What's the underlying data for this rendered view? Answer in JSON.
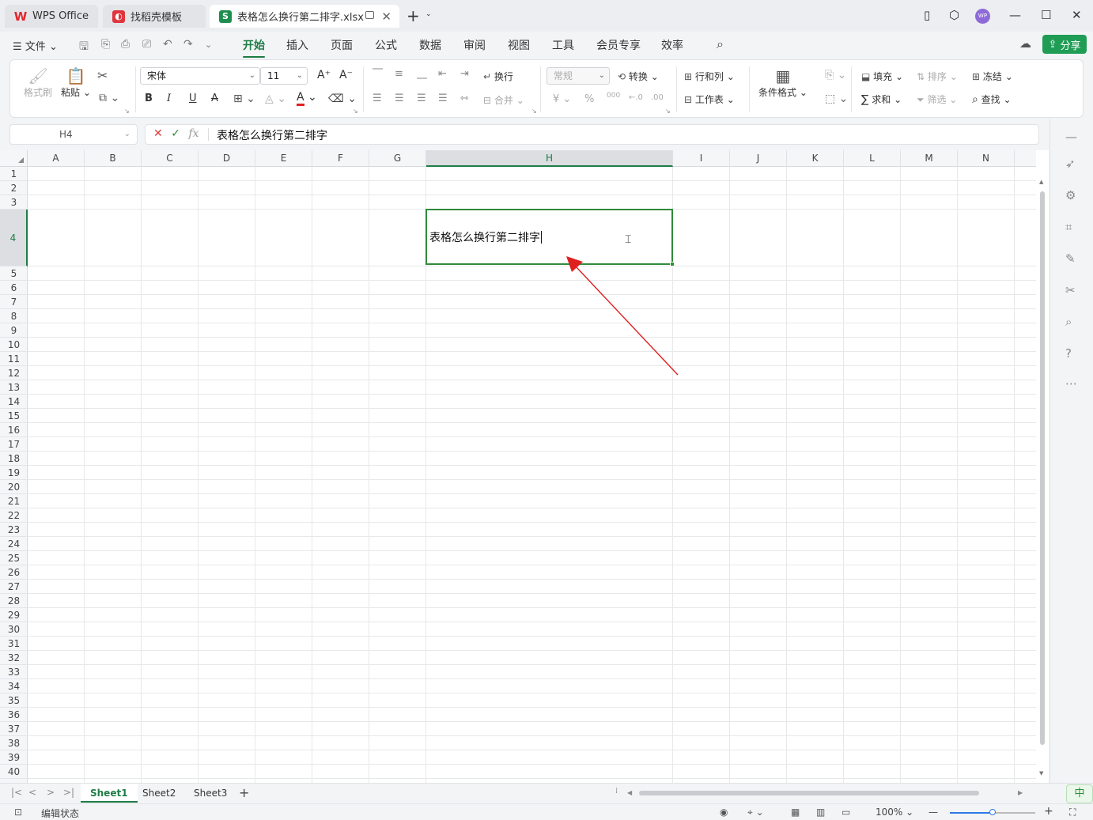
{
  "titlebar": {
    "tabs": [
      {
        "label": "WPS Office",
        "icon": "wps-logo-icon",
        "active": false
      },
      {
        "label": "找稻壳模板",
        "icon": "docer-logo-icon",
        "active": false
      },
      {
        "label": "表格怎么换行第二排字.xlsx",
        "icon": "spreadsheet-file-icon",
        "logo_letter": "S",
        "active": true
      }
    ],
    "new_tab": "+",
    "avatar_text": "WP"
  },
  "menubar": {
    "file_label": "文件",
    "tabs": [
      "开始",
      "插入",
      "页面",
      "公式",
      "数据",
      "审阅",
      "视图",
      "工具",
      "会员专享",
      "效率"
    ],
    "active_tab": "开始",
    "share_label": "分享"
  },
  "ribbon": {
    "format_painter": "格式刷",
    "paste": "粘贴",
    "font_name": "宋体",
    "font_size": "11",
    "wrap": "换行",
    "number_format": "常规",
    "convert": "转换",
    "rows_cols": "行和列",
    "worksheet": "工作表",
    "conditional_format": "条件格式",
    "fill": "填充",
    "sort": "排序",
    "freeze": "冻结",
    "sum": "求和",
    "filter": "筛选",
    "find": "查找",
    "merge": "合并",
    "currency_symbol": "¥",
    "percent_symbol": "%",
    "thousands_symbol": "000",
    "font_color": "#e02020"
  },
  "formula": {
    "name_box": "H4",
    "fx_label": "fx",
    "content": "表格怎么换行第二排字"
  },
  "grid": {
    "columns": [
      "A",
      "B",
      "C",
      "D",
      "E",
      "F",
      "G",
      "H",
      "I",
      "J",
      "K",
      "L",
      "M",
      "N"
    ],
    "selected_column": "H",
    "selected_row": 4,
    "rows": [
      "1",
      "2",
      "3",
      "4",
      "5",
      "6",
      "7",
      "8",
      "9",
      "10",
      "11",
      "12",
      "13",
      "14",
      "15",
      "16",
      "17",
      "18",
      "19",
      "20",
      "21",
      "22",
      "23",
      "24",
      "25",
      "26",
      "27",
      "28",
      "29",
      "30",
      "31",
      "32",
      "33",
      "34",
      "35",
      "36",
      "37",
      "38",
      "39",
      "40"
    ],
    "active_cell_text": "表格怎么换行第二排字",
    "accent_color": "#2e8b3a",
    "annotation_color": "#e02020"
  },
  "sheets": {
    "tabs": [
      "Sheet1",
      "Sheet2",
      "Sheet3"
    ],
    "active": "Sheet1",
    "add": "+"
  },
  "statusbar": {
    "mode": "编辑状态",
    "zoom": "100%",
    "zoom_level": 0.5,
    "ime": "中"
  }
}
